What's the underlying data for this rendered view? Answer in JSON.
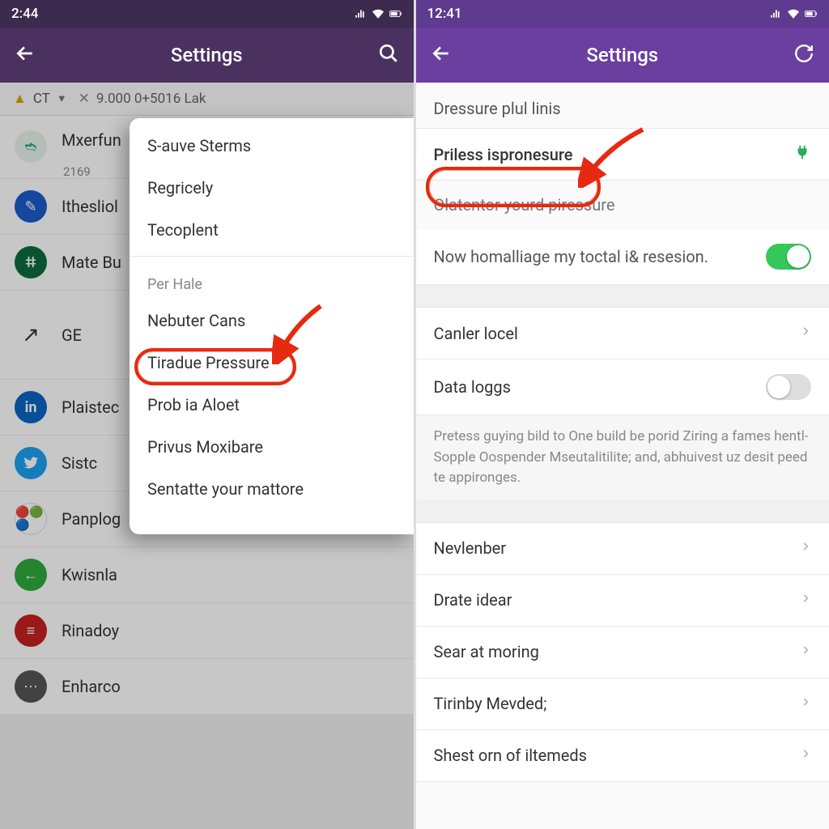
{
  "left": {
    "status_time": "2:44",
    "title": "Settings",
    "ct_line": {
      "tag": "CT",
      "rest": "9.000 0+5016 Lak"
    },
    "under_items": [
      {
        "icon_bg": "#2a8",
        "label": "Mxerfun",
        "sub": "2169"
      },
      {
        "icon_bg": "#1a5cc9",
        "label": "Ithesliol"
      },
      {
        "icon_bg": "#0d6b3f",
        "label": "Mate Bu"
      },
      {
        "icon_bg": "none",
        "label": "GE",
        "arrow": true
      },
      {
        "icon_bg": "#0a66c2",
        "label": "Plaistec",
        "glyph": "in"
      },
      {
        "icon_bg": "#1da1f2",
        "label": "Sistc",
        "glyph": "t"
      },
      {
        "icon_bg": "#fff",
        "label": "Panplog",
        "multi": true
      },
      {
        "icon_bg": "#2faa3e",
        "label": "Kwisnla",
        "glyph": "←"
      },
      {
        "icon_bg": "#c5221f",
        "label": "Rinadoy"
      },
      {
        "icon_bg": "#555",
        "label": "Enharco",
        "glyph": "⋯"
      }
    ],
    "popup": {
      "items_top": [
        "S-auve Sterms",
        "Regricely",
        "Tecoplent"
      ],
      "section": "Per Hale",
      "items_bottom": [
        "Nebuter Cans",
        "Tiradue Pressure",
        "Prob ia Aloet",
        "Privus Moxibare",
        "Sentatte your mattore"
      ]
    }
  },
  "right": {
    "status_time": "12:41",
    "title": "Settings",
    "head1": "Dressure plul linis",
    "highlight": "Priless ispronesure",
    "subhead": "Olatentor yourd piressure",
    "toggle_text": "Now homalliage my toctal i& resesion.",
    "row_canler": "Canler locel",
    "row_data": "Data loggs",
    "small_text": "Pretess guying bild to One build be porid Ziring a fames hentl-Sopple Oospender Mseutalitilite; and, abhuivest uz desit peed te appironges.",
    "list2": [
      "Nevlenber",
      "Drate idear",
      "Sear at moring",
      "Tirinby Mevded;",
      "Shest orn of iltemeds"
    ]
  }
}
